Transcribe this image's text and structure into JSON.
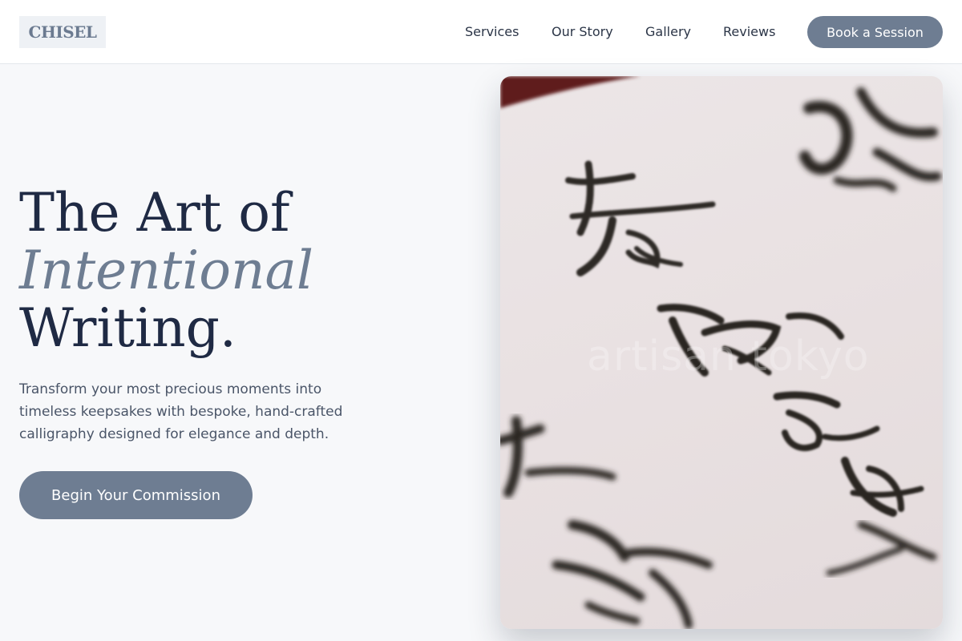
{
  "header": {
    "logo": "CHISEL",
    "nav": [
      "Services",
      "Our Story",
      "Gallery",
      "Reviews"
    ],
    "cta": "Book a Session"
  },
  "hero": {
    "headline_line1": "The Art of",
    "headline_line2": "Intentional",
    "headline_line3": "Writing.",
    "subtext": "Transform your most precious moments into timeless keepsakes with bespoke, hand-crafted calligraphy designed for elegance and depth.",
    "cta": "Begin Your Commission",
    "image_watermark": "artisan tokyo"
  },
  "colors": {
    "accent": "#6e7d92",
    "heading": "#1f2a44",
    "body_text": "#4a5568",
    "background": "#f7f8fa"
  }
}
